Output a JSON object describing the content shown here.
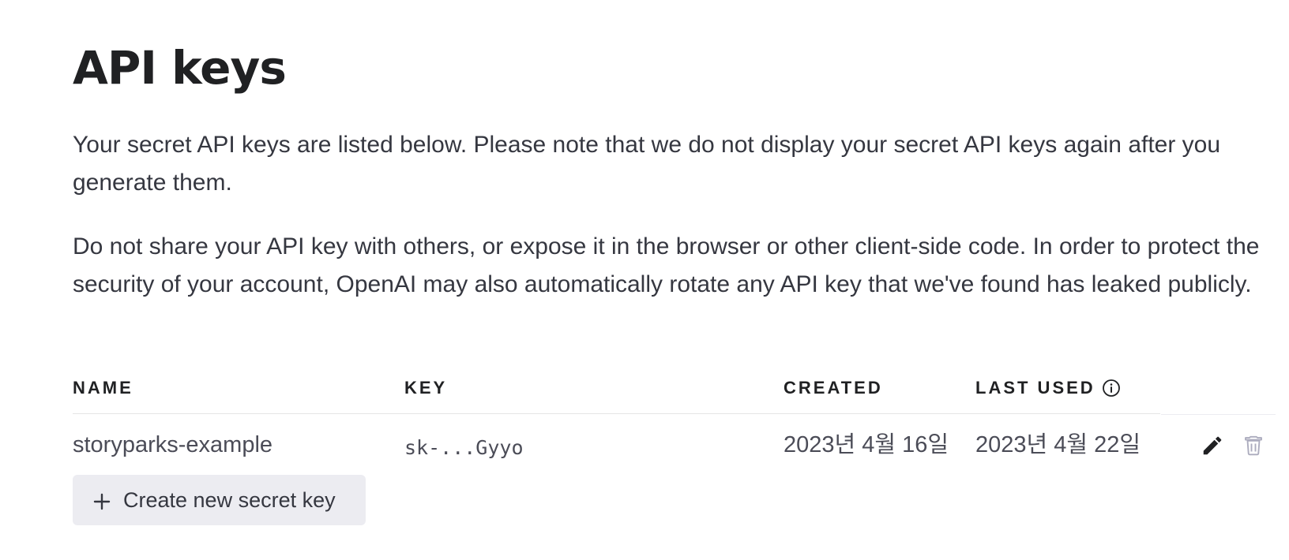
{
  "page": {
    "title": "API keys",
    "paragraphs": [
      "Your secret API keys are listed below. Please note that we do not display your secret API keys again after you generate them.",
      "Do not share your API key with others, or expose it in the browser or other client-side code. In order to protect the security of your account, OpenAI may also automatically rotate any API key that we've found has leaked publicly."
    ]
  },
  "table": {
    "headers": {
      "name": "NAME",
      "key": "KEY",
      "created": "CREATED",
      "last_used": "LAST USED"
    },
    "rows": [
      {
        "name": "storyparks-example",
        "key": "sk-...Gyyo",
        "created": "2023년 4월 16일",
        "last_used": "2023년 4월 22일"
      }
    ]
  },
  "actions": {
    "create_label": "Create new secret key"
  },
  "icons": {
    "info": "info-circle-icon",
    "edit": "pencil-icon",
    "delete": "trash-icon",
    "plus": "plus-icon"
  },
  "colors": {
    "text_primary": "#202123",
    "text_body": "#353740",
    "button_bg": "#ececf1",
    "icon_muted": "#acacbe"
  }
}
